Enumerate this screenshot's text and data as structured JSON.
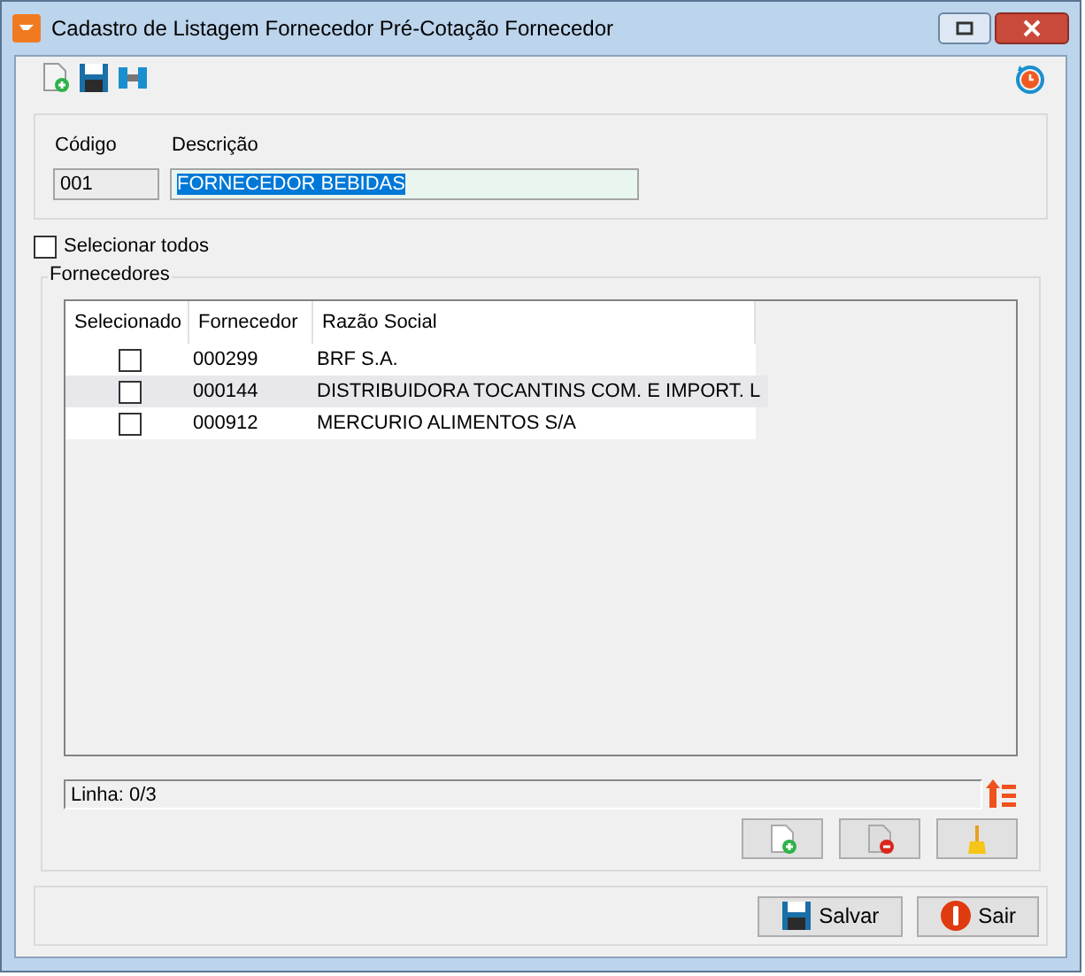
{
  "window": {
    "title": "Cadastro de Listagem Fornecedor Pré-Cotação Fornecedor"
  },
  "form": {
    "code_label": "Código",
    "code_value": "001",
    "description_label": "Descrição",
    "description_value": "FORNECEDOR BEBIDAS"
  },
  "select_all": {
    "label": "Selecionar todos",
    "checked": false
  },
  "group": {
    "title": "Fornecedores"
  },
  "table": {
    "columns": [
      "Selecionado",
      "Fornecedor",
      "Razão Social"
    ],
    "rows": [
      {
        "checked": false,
        "code": "000299",
        "name": "BRF S.A."
      },
      {
        "checked": false,
        "code": "000144",
        "name": "DISTRIBUIDORA TOCANTINS COM. E IMPORT. L"
      },
      {
        "checked": false,
        "code": "000912",
        "name": "MERCURIO ALIMENTOS S/A"
      }
    ]
  },
  "status": "Linha: 0/3",
  "buttons": [
    {
      "label": "Salvar",
      "kind": "save"
    },
    {
      "label": "Sair",
      "kind": "exit"
    }
  ]
}
